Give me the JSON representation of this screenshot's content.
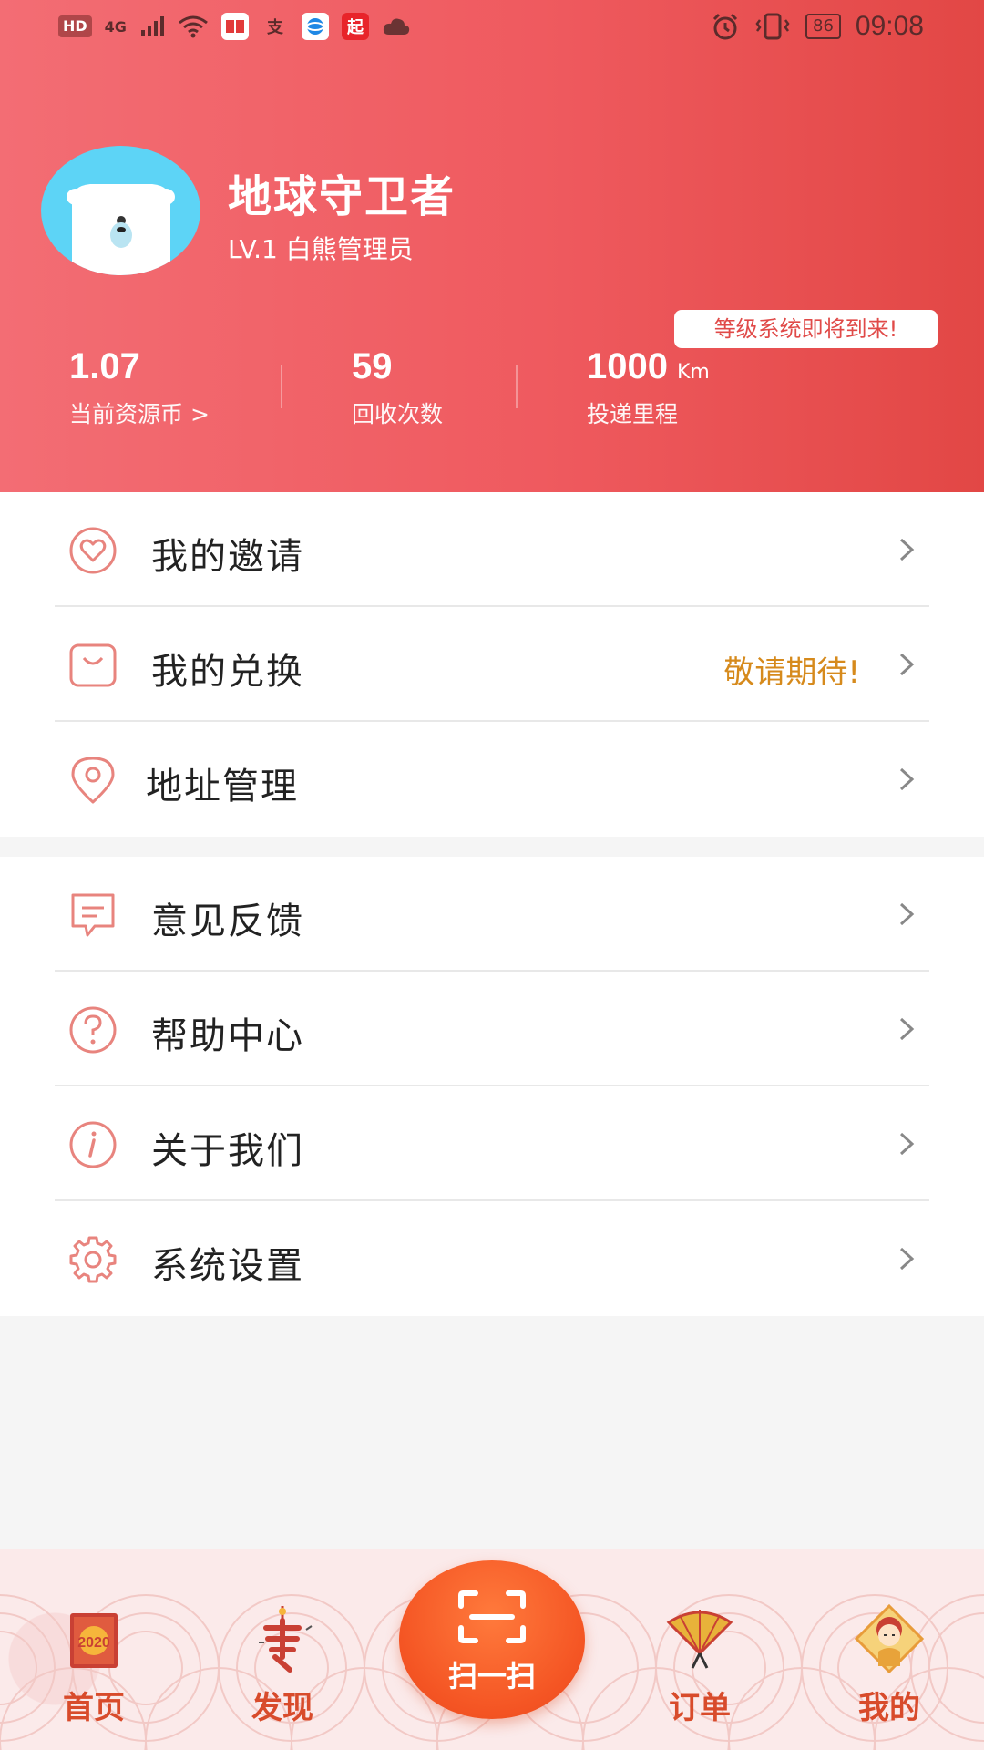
{
  "status_bar": {
    "hd": "HD",
    "network": "4G",
    "battery": "86",
    "time": "09:08",
    "app_icons": [
      "book-icon",
      "alipay-icon",
      "browser-icon",
      "qidian-icon",
      "cloud-icon"
    ],
    "qidian_label": "起",
    "alipay_label": "支"
  },
  "profile": {
    "username": "地球守卫者",
    "level": "LV.1 白熊管理员",
    "level_notice": "等级系统即将到来!"
  },
  "stats": [
    {
      "value": "1.07",
      "unit": "",
      "label": "当前资源币 >"
    },
    {
      "value": "59",
      "unit": "",
      "label": "回收次数"
    },
    {
      "value": "1000",
      "unit": "Km",
      "label": "投递里程"
    }
  ],
  "menu_group_1": [
    {
      "label": "我的邀请",
      "icon": "heart-icon",
      "extra": ""
    },
    {
      "label": "我的兑换",
      "icon": "bag-icon",
      "extra": "敬请期待!"
    },
    {
      "label": "地址管理",
      "icon": "location-pin-icon",
      "extra": ""
    }
  ],
  "menu_group_2": [
    {
      "label": "意见反馈",
      "icon": "message-icon",
      "extra": ""
    },
    {
      "label": "帮助中心",
      "icon": "question-icon",
      "extra": ""
    },
    {
      "label": "关于我们",
      "icon": "info-icon",
      "extra": ""
    },
    {
      "label": "系统设置",
      "icon": "gear-icon",
      "extra": ""
    }
  ],
  "bottom_nav": {
    "home": "首页",
    "home_badge": "2020",
    "discover": "发现",
    "scan": "扫一扫",
    "orders": "订单",
    "mine": "我的"
  },
  "colors": {
    "header_start": "#f36d74",
    "header_end": "#e24745",
    "icon_stroke": "#e8847e",
    "accent_text": "#d68a1c",
    "scan_button": "#f45423"
  }
}
